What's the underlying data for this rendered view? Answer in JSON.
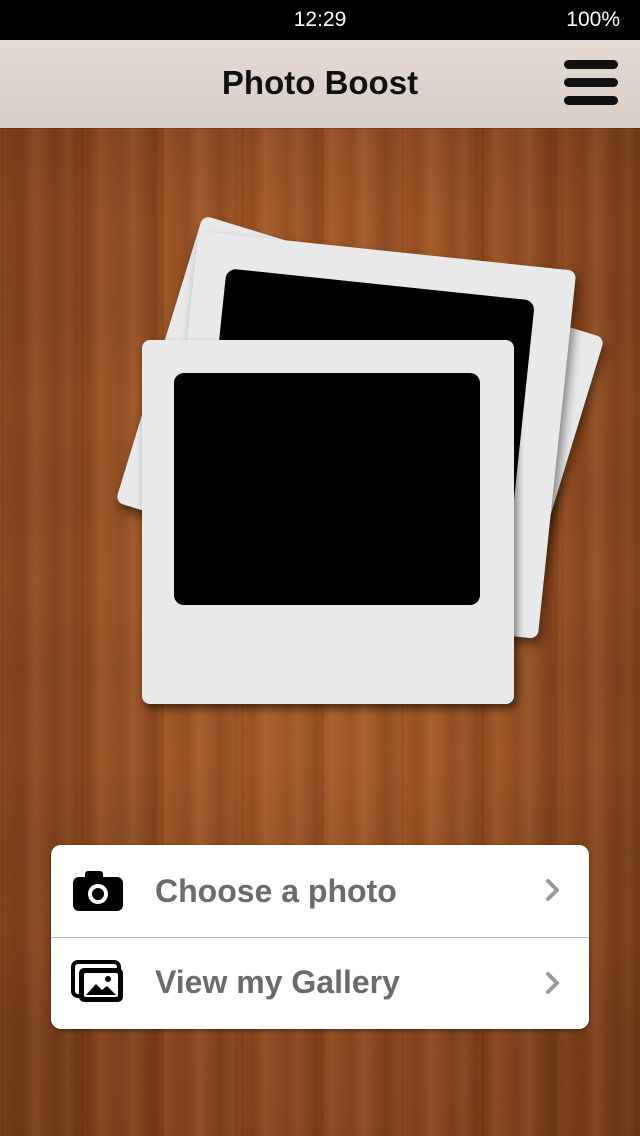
{
  "status_bar": {
    "time": "12:29",
    "battery": "100%"
  },
  "nav": {
    "title": "Photo Boost",
    "menu_icon": "hamburger-menu-icon"
  },
  "actions": [
    {
      "label": "Choose a photo",
      "icon": "camera-icon"
    },
    {
      "label": "View my Gallery",
      "icon": "gallery-icon"
    }
  ],
  "colors": {
    "nav_background": "#dcd3cc",
    "label_text": "#6b6b6b",
    "chevron": "#9a9a9a"
  }
}
